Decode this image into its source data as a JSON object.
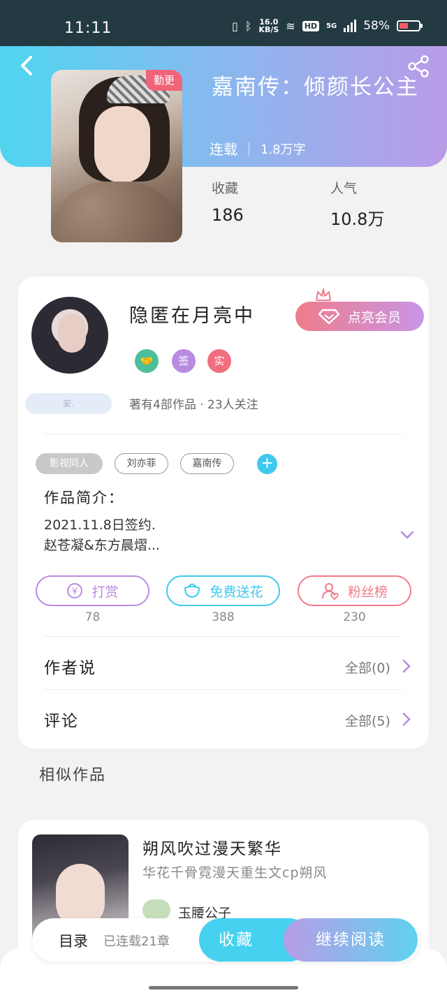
{
  "status_bar": {
    "time": "11:11",
    "net_speed_value": "16.0",
    "net_speed_unit": "KB/S",
    "hd": "HD",
    "network": "5G",
    "battery": "58%"
  },
  "book": {
    "cover_tag": "勤更",
    "title": "嘉南传：倾颜长公主",
    "status": "连载",
    "word_count": "1.8万字",
    "stats": [
      {
        "label": "收藏",
        "value": "186"
      },
      {
        "label": "人气",
        "value": "10.8万"
      }
    ]
  },
  "author": {
    "name": "隐匿在月亮中",
    "vip_button": "点亮会员",
    "badges": [
      "签",
      "实"
    ],
    "badge_name": "安.",
    "meta": "著有4部作品 · 23人关注"
  },
  "tags": [
    "影视同人",
    "刘亦菲",
    "嘉南传"
  ],
  "intro": {
    "title": "作品简介：",
    "line1": "2021.11.8日签约.",
    "line2": "赵苍凝&东方晨熠..."
  },
  "actions": [
    {
      "label": "打赏",
      "count": "78",
      "color": "#b98be0"
    },
    {
      "label": "免费送花",
      "count": "388",
      "color": "#3ec9ef"
    },
    {
      "label": "粉丝榜",
      "count": "230",
      "color": "#ef7c8a"
    }
  ],
  "rows": [
    {
      "title": "作者说",
      "right": "全部(0)"
    },
    {
      "title": "评论",
      "right": "全部(5)"
    }
  ],
  "similar": {
    "heading": "相似作品",
    "title": "朔风吹过漫天繁华",
    "desc": "华花千骨霓漫天重生文cp朔风",
    "author": "玉腰公子"
  },
  "bottom": {
    "toc": "目录",
    "toc_sub": "已连载21章",
    "favorite": "收藏",
    "continue": "继续阅读"
  },
  "colors": {
    "accent_blue": "#45d1ef",
    "accent_purple": "#b98be0",
    "accent_red": "#ef7c8a"
  }
}
